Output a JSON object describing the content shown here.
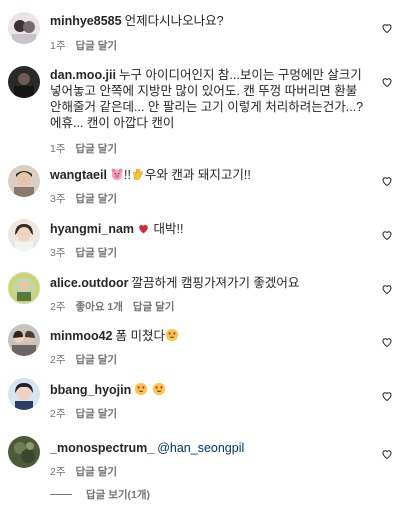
{
  "comments": [
    {
      "username": "minhye8585",
      "text": "언제다시나오나요?",
      "time": "1주",
      "reply": "답글 달기",
      "likes": ""
    },
    {
      "username": "dan.moo.jii",
      "text": "누구 아이디어인지 참...보이는 구멍에만 살크기 넣어놓고 안쪽에 지방만 많이 있어도. 캔 뚜껑 따버리면 환불 안해줄거 같은데... 안 팔리는 고기 이렇게 처리하려는건가...? 에휴... 캔이 아깝다 캔이",
      "time": "1주",
      "reply": "답글 달기",
      "likes": ""
    },
    {
      "username": "wangtaeil",
      "text_pre": "",
      "emoji_mid": "!!",
      "text": "우와 캔과 돼지고기!!",
      "time": "3주",
      "reply": "답글 달기",
      "likes": ""
    },
    {
      "username": "hyangmi_nam",
      "text": "대박!!",
      "time": "3주",
      "reply": "답글 달기",
      "likes": ""
    },
    {
      "username": "alice.outdoor",
      "text": "깔끔하게 캠핑가져가기 좋겠어요",
      "time": "2주",
      "reply": "답글 달기",
      "likes": "좋아요 1개"
    },
    {
      "username": "minmoo42",
      "text": "폼 미쳤다",
      "time": "2주",
      "reply": "답글 달기",
      "likes": ""
    },
    {
      "username": "bbang_hyojin",
      "text": "",
      "time": "2주",
      "reply": "답글 달기",
      "likes": ""
    },
    {
      "username": "_monospectrum_",
      "mention": "@han_seongpil",
      "text": "",
      "time": "2주",
      "reply": "답글 달기",
      "likes": ""
    }
  ],
  "view_replies": "답글 보기(1개)",
  "colors": {
    "text": "#262626",
    "meta": "#737373",
    "mention": "#00376b",
    "heart_red": "#d7263d"
  }
}
